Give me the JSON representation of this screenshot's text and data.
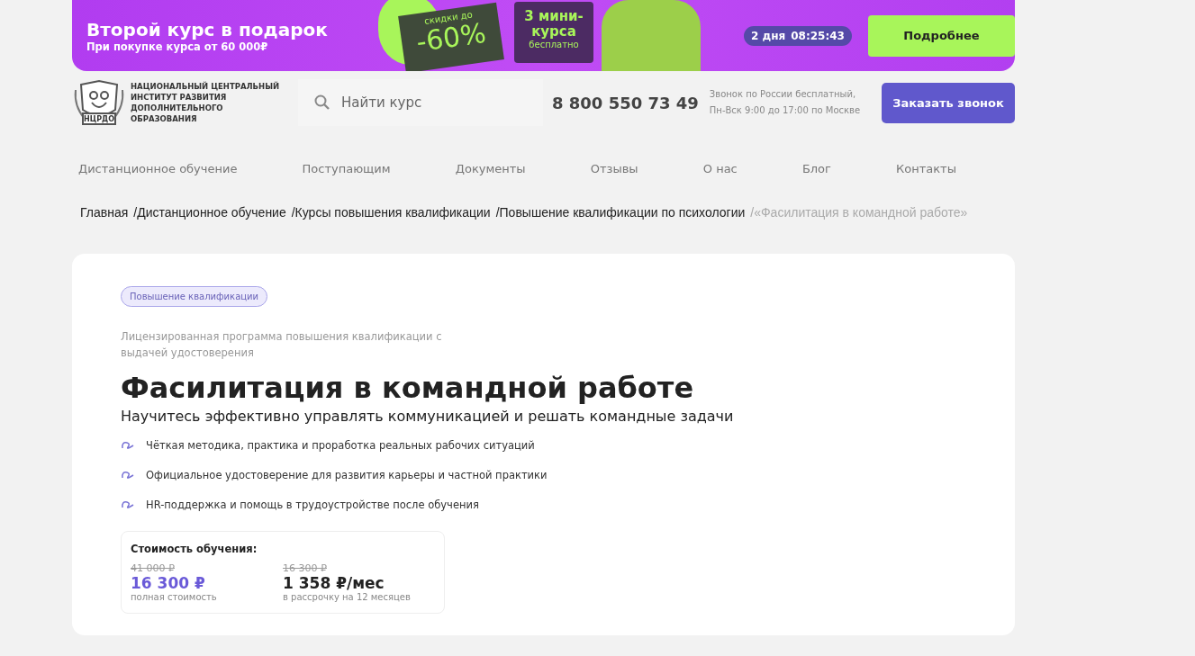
{
  "banner": {
    "title": "Второй курс в подарок",
    "subtitle": "При покупке курса от 60 000₽",
    "discount_caption": "скидки до",
    "discount": "-60%",
    "mini_title": "3 мини-курса",
    "mini_caption": "бесплатно",
    "timer_days": "2 дня",
    "timer_time": "08:25:43",
    "button": "Подробнее"
  },
  "header": {
    "logo_caption": "НЦРДО",
    "org_name": "НАЦИОНАЛЬНЫЙ ЦЕНТРАЛЬНЫЙ ИНСТИТУТ РАЗВИТИЯ ДОПОЛНИТЕЛЬНОГО ОБРАЗОВАНИЯ",
    "search": {
      "placeholder": "Найти курс"
    },
    "phone": "8 800 550 73 49",
    "phone_note": "Звонок по России бесплатный, Пн-Вск 9:00 до 17:00 по Москве",
    "call_button": "Заказать звонок"
  },
  "nav": [
    "Дистанционное обучение",
    "Поступающим",
    "Документы",
    "Отзывы",
    "О нас",
    "Блог",
    "Контакты"
  ],
  "breadcrumbs": [
    {
      "label": "Главная",
      "current": false
    },
    {
      "label": "/Дистанционное обучение",
      "current": false
    },
    {
      "label": "/Курсы повышения квалификации",
      "current": false
    },
    {
      "label": "/Повышение квалификации по психологии",
      "current": false
    },
    {
      "label": "/«Фасилитация в командной работе»",
      "current": true
    }
  ],
  "course": {
    "tag": "Повышение квалификации",
    "license": "Лицензированная программа повышения квалификации с выдачей удостоверения",
    "title": "Фасилитация в командной работе",
    "subtitle": "Научитесь эффективно управлять коммуникацией и решать командные задачи",
    "features": [
      "Чёткая методика, практика и проработка реальных рабочих ситуаций",
      "Официальное удостоверение для развития карьеры и частной практики",
      "HR-поддержка и помощь в трудоустройстве после обучения"
    ],
    "price": {
      "title": "Стоимость обучения:",
      "options": [
        {
          "old": "41 000 ₽",
          "price": "16 300  ₽",
          "note": "полная стоимость",
          "accent": true
        },
        {
          "old": "16 300 ₽",
          "price": "1 358 ₽/мес",
          "note": "в рассрочку на 12 месяцев",
          "accent": false
        }
      ]
    }
  }
}
